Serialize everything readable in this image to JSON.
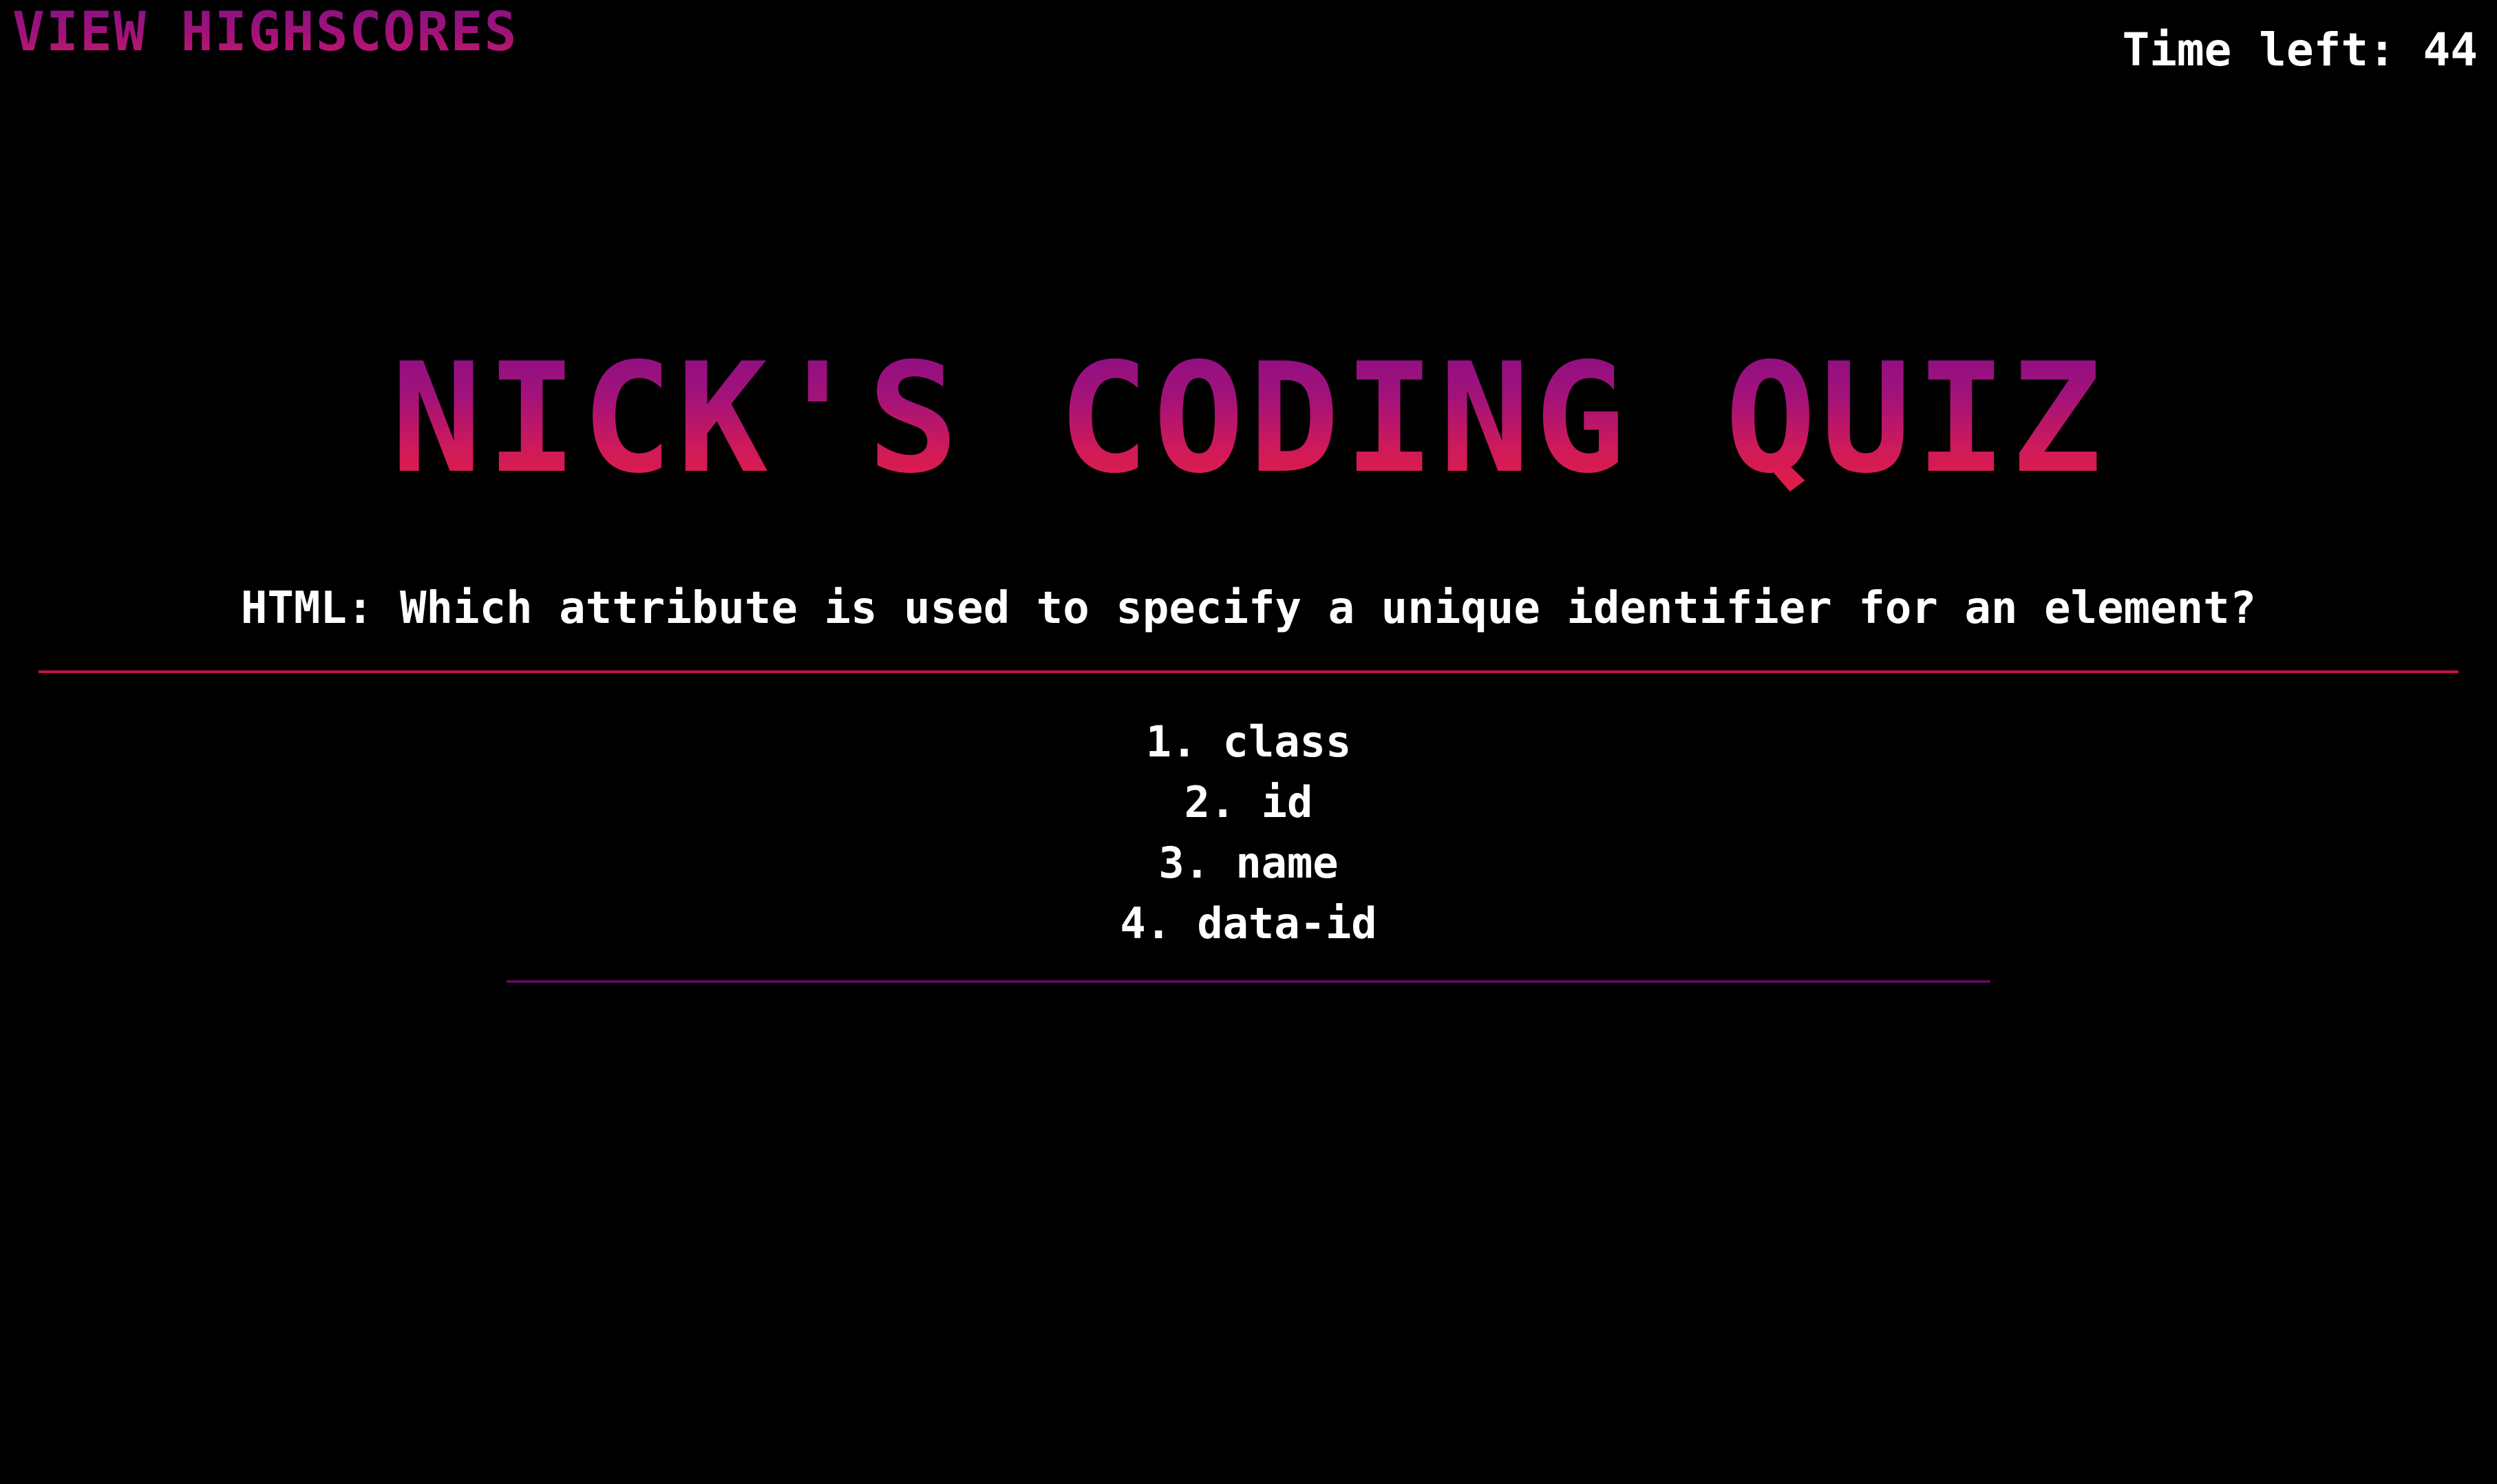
{
  "header": {
    "highscores_label": "VIEW HIGHSCORES",
    "timer_text": "Time left: 44"
  },
  "title": "NICK'S CODING QUIZ",
  "quiz": {
    "question": "HTML: Which attribute is used to specify a unique identifier for an element?",
    "answers": [
      "1. class",
      "2. id",
      "3. name",
      "4. data-id"
    ]
  },
  "colors": {
    "background": "#000000",
    "text": "#ffffff",
    "accent_purple": "#8a0f86",
    "accent_red": "#e41d45",
    "divider": "#c0124e"
  }
}
